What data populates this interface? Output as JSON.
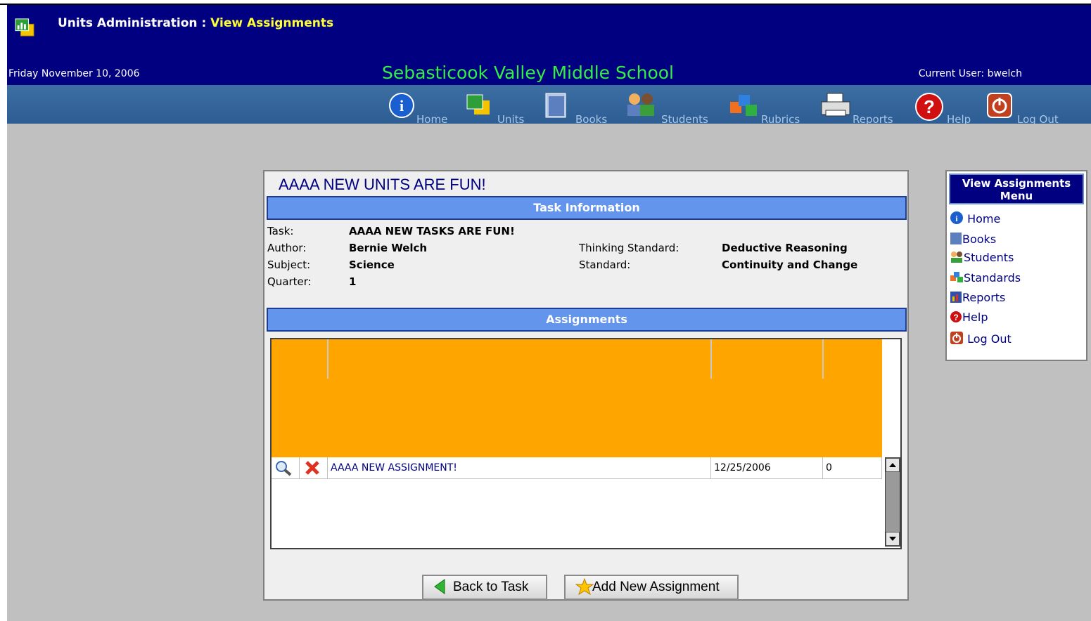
{
  "header": {
    "app_title": "Units Administration :",
    "app_subtitle": "View Assignments",
    "date": "Friday November 10, 2006",
    "school": "Sebasticook Valley Middle School",
    "current_user": "Current User: bwelch"
  },
  "nav": [
    {
      "label": "Home",
      "icon": "info-icon"
    },
    {
      "label": "Units",
      "icon": "units-icon"
    },
    {
      "label": "Books",
      "icon": "books-icon"
    },
    {
      "label": "Students",
      "icon": "students-icon"
    },
    {
      "label": "Rubrics",
      "icon": "rubrics-icon"
    },
    {
      "label": "Reports",
      "icon": "printer-icon"
    },
    {
      "label": "Help",
      "icon": "help-icon"
    },
    {
      "label": "Log Out",
      "icon": "power-icon"
    }
  ],
  "panel": {
    "unit_title": "AAAA NEW UNITS ARE FUN!",
    "task_section": "Task Information",
    "task": {
      "label": "Task:",
      "value": "AAAA NEW TASKS ARE FUN!"
    },
    "author": {
      "label": "Author:",
      "value": "Bernie Welch"
    },
    "subject": {
      "label": "Subject:",
      "value": "Science"
    },
    "quarter": {
      "label": "Quarter:",
      "value": "1"
    },
    "thinking_standard": {
      "label": "Thinking Standard:",
      "value": "Deductive Reasoning"
    },
    "standard": {
      "label": "Standard:",
      "value": "Continuity and Change"
    },
    "assignments_section": "Assignments"
  },
  "assignments": [
    {
      "name": "AAAA NEW ASSIGNMENT!",
      "date": "12/25/2006",
      "count": "0"
    }
  ],
  "buttons": {
    "back": "Back to Task",
    "add": "Add New Assignment"
  },
  "side_menu": {
    "title": "View Assignments Menu",
    "items": [
      "Home",
      "Books",
      "Students",
      "Standards",
      "Reports",
      "Help",
      "Log Out"
    ]
  },
  "colors": {
    "header_bg": "#000080",
    "school_text": "#33ee44",
    "section_bar": "#6495ed",
    "grid_header": "#ffa500"
  }
}
